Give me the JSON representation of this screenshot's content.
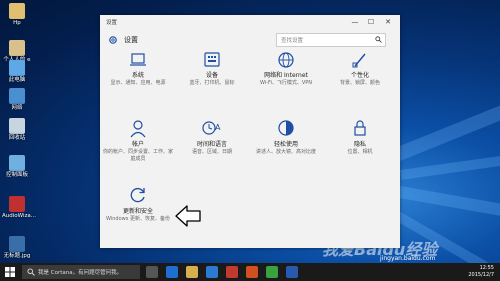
{
  "desktop": {
    "icons": [
      {
        "label": "Hp"
      },
      {
        "label": "个人人的 e"
      },
      {
        "label": "此电脑"
      },
      {
        "label": "网络"
      },
      {
        "label": "回收站"
      },
      {
        "label": "控制面板"
      },
      {
        "label": "AudioWiza..."
      },
      {
        "label": "无标题.jpg"
      }
    ]
  },
  "settings_window": {
    "title": "设置",
    "heading": "设置",
    "search_placeholder": "查找设置",
    "controls": {
      "minimize": "—",
      "maximize": "☐",
      "close": "✕"
    },
    "tiles": [
      {
        "name": "系统",
        "desc": "显示、通知、应用、电源"
      },
      {
        "name": "设备",
        "desc": "蓝牙、打印机、鼠标"
      },
      {
        "name": "网络和 Internet",
        "desc": "Wi-Fi、飞行模式、VPN"
      },
      {
        "name": "个性化",
        "desc": "背景、锁屏、颜色"
      },
      {
        "name": "帐户",
        "desc": "你的帐户、同步设置、工作、家庭成员"
      },
      {
        "name": "时间和语言",
        "desc": "语音、区域、日期"
      },
      {
        "name": "轻松使用",
        "desc": "讲述人、放大镜、高对比度"
      },
      {
        "name": "隐私",
        "desc": "位置、相机"
      },
      {
        "name": "更新和安全",
        "desc": "Windows 更新、恢复、备份"
      }
    ]
  },
  "taskbar": {
    "search_placeholder": "我是 Cortana，有问题尽管问我。",
    "clock_time": "12:55",
    "clock_date": "2015/12/7"
  },
  "watermark": {
    "text": "我爱Baidu经验",
    "url": "jingyan.baidu.com"
  },
  "colors": {
    "accent": "#1e4fa3",
    "window_bg": "#f2f2f2",
    "taskbar_bg": "#1a1a1a"
  }
}
